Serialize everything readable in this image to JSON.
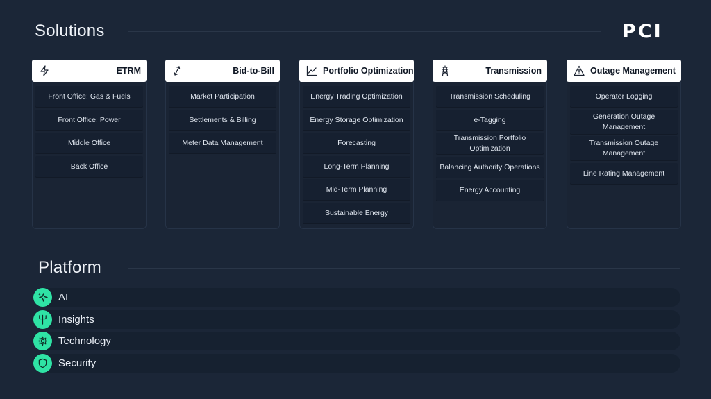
{
  "header": {
    "title": "Solutions",
    "logo_text": "PCI"
  },
  "columns": [
    {
      "title": "ETRM",
      "icon": "lightning-icon",
      "items": [
        "Front Office: Gas & Fuels",
        "Front Office: Power",
        "Middle Office",
        "Back Office"
      ]
    },
    {
      "title": "Bid-to-Bill",
      "icon": "exchange-arrows-icon",
      "items": [
        "Market Participation",
        "Settlements & Billing",
        "Meter Data Management"
      ]
    },
    {
      "title": "Portfolio Optimization",
      "icon": "line-chart-icon",
      "items": [
        "Energy Trading Optimization",
        "Energy Storage Optimization",
        "Forecasting",
        "Long-Term Planning",
        "Mid-Term Planning",
        "Sustainable Energy"
      ]
    },
    {
      "title": "Transmission",
      "icon": "transmission-tower-icon",
      "items": [
        "Transmission Scheduling",
        "e-Tagging",
        "Transmission Portfolio Optimization",
        "Balancing Authority Operations",
        "Energy Accounting"
      ]
    },
    {
      "title": "Outage Management",
      "icon": "warning-triangle-icon",
      "items": [
        "Operator Logging",
        "Generation Outage Management",
        "Transmission Outage Management",
        "Line Rating Management"
      ]
    }
  ],
  "platform": {
    "title": "Platform",
    "items": [
      {
        "label": "AI",
        "icon": "sparkle-icon"
      },
      {
        "label": "Insights",
        "icon": "insights-icon"
      },
      {
        "label": "Technology",
        "icon": "gear-icon"
      },
      {
        "label": "Security",
        "icon": "shield-icon"
      }
    ]
  },
  "colors": {
    "accent": "#2fe3a5",
    "background": "#1b2637",
    "header_bg": "#ffffff"
  }
}
